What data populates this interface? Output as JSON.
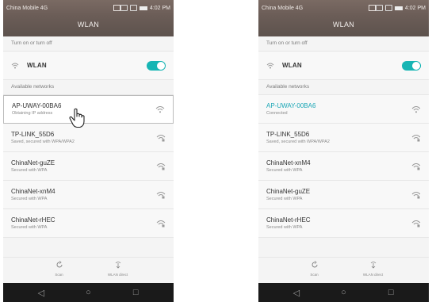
{
  "screens": [
    {
      "status": {
        "carrier": "China Mobile 4G",
        "time": "4:02 PM"
      },
      "title": "WLAN",
      "toggle_section": "Turn on or turn off",
      "wlan_label": "WLAN",
      "wlan_enabled": true,
      "available_label": "Available networks",
      "networks": [
        {
          "name": "AP-UWAY-00BA6",
          "status": "Obtaining IP address"
        },
        {
          "name": "TP-LINK_55D6",
          "status": "Saved, secured with WPA/WPA2"
        },
        {
          "name": "ChinaNet-guZE",
          "status": "Secured with WPA"
        },
        {
          "name": "ChinaNet-xnM4",
          "status": "Secured with WPA"
        },
        {
          "name": "ChinaNet-rHEC",
          "status": "Secured with WPA"
        }
      ],
      "actions": {
        "scan": "Scan",
        "direct": "WLAN direct"
      }
    },
    {
      "status": {
        "carrier": "China Mobile 4G",
        "time": "4:02 PM"
      },
      "title": "WLAN",
      "toggle_section": "Turn on or turn off",
      "wlan_label": "WLAN",
      "wlan_enabled": true,
      "available_label": "Available networks",
      "networks": [
        {
          "name": "AP-UWAY-00BA6",
          "status": "Connected"
        },
        {
          "name": "TP-LINK_55D6",
          "status": "Saved, secured with WPA/WPA2"
        },
        {
          "name": "ChinaNet-xnM4",
          "status": "Secured with WPA"
        },
        {
          "name": "ChinaNet-guZE",
          "status": "Secured with WPA"
        },
        {
          "name": "ChinaNet-rHEC",
          "status": "Secured with WPA"
        }
      ],
      "actions": {
        "scan": "Scan",
        "direct": "WLAN direct"
      }
    }
  ],
  "colors": {
    "accent": "#17b5b4",
    "titlebar": "#6b5d57",
    "connected": "#1aa6b5"
  },
  "icons": [
    "wifi-icon",
    "scan-icon",
    "wlan-direct-icon",
    "back-icon",
    "home-icon",
    "recents-icon",
    "hand-cursor-icon"
  ]
}
